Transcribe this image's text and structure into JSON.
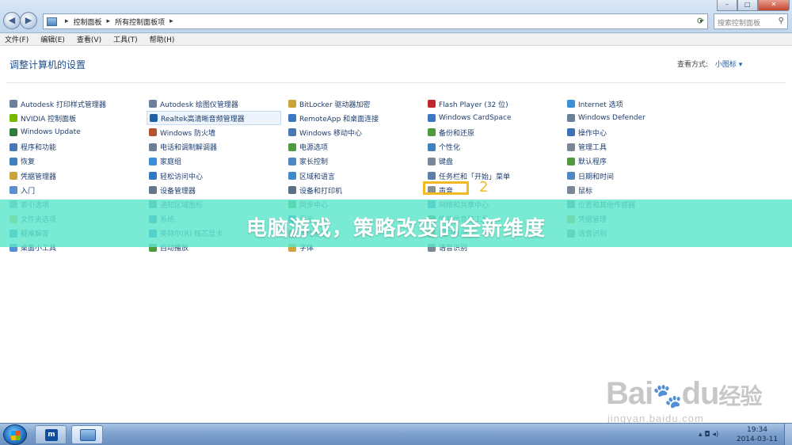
{
  "window": {
    "breadcrumb": [
      "控制面板",
      "所有控制面板项"
    ],
    "search_placeholder": "搜索控制面板",
    "buttons": {
      "minimize": "–",
      "maximize": "□",
      "close": "✕"
    }
  },
  "menu": [
    "文件(F)",
    "编辑(E)",
    "查看(V)",
    "工具(T)",
    "帮助(H)"
  ],
  "content": {
    "title": "调整计算机的设置",
    "view_by_label": "查看方式:",
    "view_by_value": "小图标 ▾"
  },
  "columns": [
    [
      {
        "label": "Autodesk 打印样式管理器",
        "icon": "printer-style-icon",
        "color": "#6a7f99"
      },
      {
        "label": "NVIDIA 控制面板",
        "icon": "nvidia-icon",
        "color": "#76b900"
      },
      {
        "label": "Windows Update",
        "icon": "windows-update-icon",
        "color": "#2f7d3a"
      },
      {
        "label": "程序和功能",
        "icon": "programs-icon",
        "color": "#4a78b5"
      },
      {
        "label": "恢复",
        "icon": "recovery-icon",
        "color": "#3f7fbf"
      },
      {
        "label": "凭据管理器",
        "icon": "credential-icon",
        "color": "#c9a43a"
      },
      {
        "label": "入门",
        "icon": "getting-started-icon",
        "color": "#5b8fd0"
      },
      {
        "label": "索引选项",
        "icon": "indexing-icon",
        "color": "#7aa0c8"
      },
      {
        "label": "文件夹选项",
        "icon": "folder-options-icon",
        "color": "#e0b84a"
      },
      {
        "label": "疑难解答",
        "icon": "troubleshoot-icon",
        "color": "#3f86c9"
      },
      {
        "label": "桌面小工具",
        "icon": "gadgets-icon",
        "color": "#4f8fd3"
      }
    ],
    [
      {
        "label": "Autodesk 绘图仪管理器",
        "icon": "plotter-icon",
        "color": "#6a7f99"
      },
      {
        "label": "Realtek高清晰音频管理器",
        "icon": "realtek-icon",
        "color": "#1f5fa8",
        "hl": true
      },
      {
        "label": "Windows 防火墙",
        "icon": "firewall-icon",
        "color": "#b5532f"
      },
      {
        "label": "电话和调制解调器",
        "icon": "phone-modem-icon",
        "color": "#6d7f95"
      },
      {
        "label": "家庭组",
        "icon": "homegroup-icon",
        "color": "#3a8fd8"
      },
      {
        "label": "轻松访问中心",
        "icon": "ease-of-access-icon",
        "color": "#2f79c6"
      },
      {
        "label": "设备管理器",
        "icon": "device-manager-icon",
        "color": "#66768a"
      },
      {
        "label": "通知区域图标",
        "icon": "notification-icon",
        "color": "#5b7fa8"
      },
      {
        "label": "系统",
        "icon": "system-icon",
        "color": "#4a78b5"
      },
      {
        "label": "英特尔(R) 核芯显卡",
        "icon": "intel-graphics-icon",
        "color": "#2b73c2"
      },
      {
        "label": "自动播放",
        "icon": "autoplay-icon",
        "color": "#4e9a3c"
      }
    ],
    [
      {
        "label": "BitLocker 驱动器加密",
        "icon": "bitlocker-icon",
        "color": "#c9a43a"
      },
      {
        "label": "RemoteApp 和桌面连接",
        "icon": "remoteapp-icon",
        "color": "#3a78c2"
      },
      {
        "label": "Windows 移动中心",
        "icon": "mobility-center-icon",
        "color": "#4a78b5"
      },
      {
        "label": "电源选项",
        "icon": "power-options-icon",
        "color": "#4f9a3f"
      },
      {
        "label": "家长控制",
        "icon": "parental-controls-icon",
        "color": "#4f86c4"
      },
      {
        "label": "区域和语言",
        "icon": "region-icon",
        "color": "#3f8ac8"
      },
      {
        "label": "设备和打印机",
        "icon": "devices-printers-icon",
        "color": "#5d6f86"
      },
      {
        "label": "同步中心",
        "icon": "sync-center-icon",
        "color": "#3fa34d"
      },
      {
        "label": "显示",
        "icon": "display-icon",
        "color": "#3f7fbf"
      },
      {
        "label": "颜色管理",
        "icon": "color-management-icon",
        "color": "#c4504a"
      },
      {
        "label": "字体",
        "icon": "fonts-icon",
        "color": "#d0a43a"
      }
    ],
    [
      {
        "label": "Flash Player (32 位)",
        "icon": "flash-icon",
        "color": "#c0282d"
      },
      {
        "label": "Windows CardSpace",
        "icon": "cardspace-icon",
        "color": "#3a78c2"
      },
      {
        "label": "备份和还原",
        "icon": "backup-icon",
        "color": "#4f9a3f"
      },
      {
        "label": "个性化",
        "icon": "personalization-icon",
        "color": "#3f7fbf"
      },
      {
        "label": "键盘",
        "icon": "keyboard-icon",
        "color": "#7a8797"
      },
      {
        "label": "任务栏和「开始」菜单",
        "icon": "taskbar-icon",
        "color": "#5b7fa8"
      },
      {
        "label": "声音",
        "icon": "sound-icon",
        "color": "#8a8f96"
      },
      {
        "label": "网络和共享中心",
        "icon": "network-icon",
        "color": "#3f86c9"
      },
      {
        "label": "性能信息和工具",
        "icon": "performance-icon",
        "color": "#4a8f4a"
      },
      {
        "label": "用户帐户",
        "icon": "user-accounts-icon",
        "color": "#d08a3a"
      },
      {
        "label": "语音识别",
        "icon": "speech-icon",
        "color": "#7a8797"
      }
    ],
    [
      {
        "label": "Internet 选项",
        "icon": "internet-options-icon",
        "color": "#3a8fd8"
      },
      {
        "label": "Windows Defender",
        "icon": "defender-icon",
        "color": "#6a7f99"
      },
      {
        "label": "操作中心",
        "icon": "action-center-icon",
        "color": "#3f6fb5"
      },
      {
        "label": "管理工具",
        "icon": "admin-tools-icon",
        "color": "#7a8797"
      },
      {
        "label": "默认程序",
        "icon": "default-programs-icon",
        "color": "#4f9a3f"
      },
      {
        "label": "日期和时间",
        "icon": "date-time-icon",
        "color": "#4f86c4"
      },
      {
        "label": "鼠标",
        "icon": "mouse-icon",
        "color": "#7a8797"
      },
      {
        "label": "位置和其他传感器",
        "icon": "location-icon",
        "color": "#5b7fa8"
      },
      {
        "label": "凭据管理",
        "icon": "credential-manage-icon",
        "color": "#c9a43a"
      },
      {
        "label": "语音识别",
        "icon": "speech-recognition-icon",
        "color": "#7a8797"
      }
    ]
  ],
  "annotation": {
    "number": "2"
  },
  "banner": {
    "text": "电脑游戏，策略改变的全新维度"
  },
  "watermark": {
    "logo_text": "Bai",
    "logo_tail": "du",
    "logo_cn": "经验",
    "url": "jingyan.baidu.com"
  },
  "taskbar": {
    "time": "19:34",
    "date": "2014-03-11",
    "task1_glyph": "m"
  }
}
